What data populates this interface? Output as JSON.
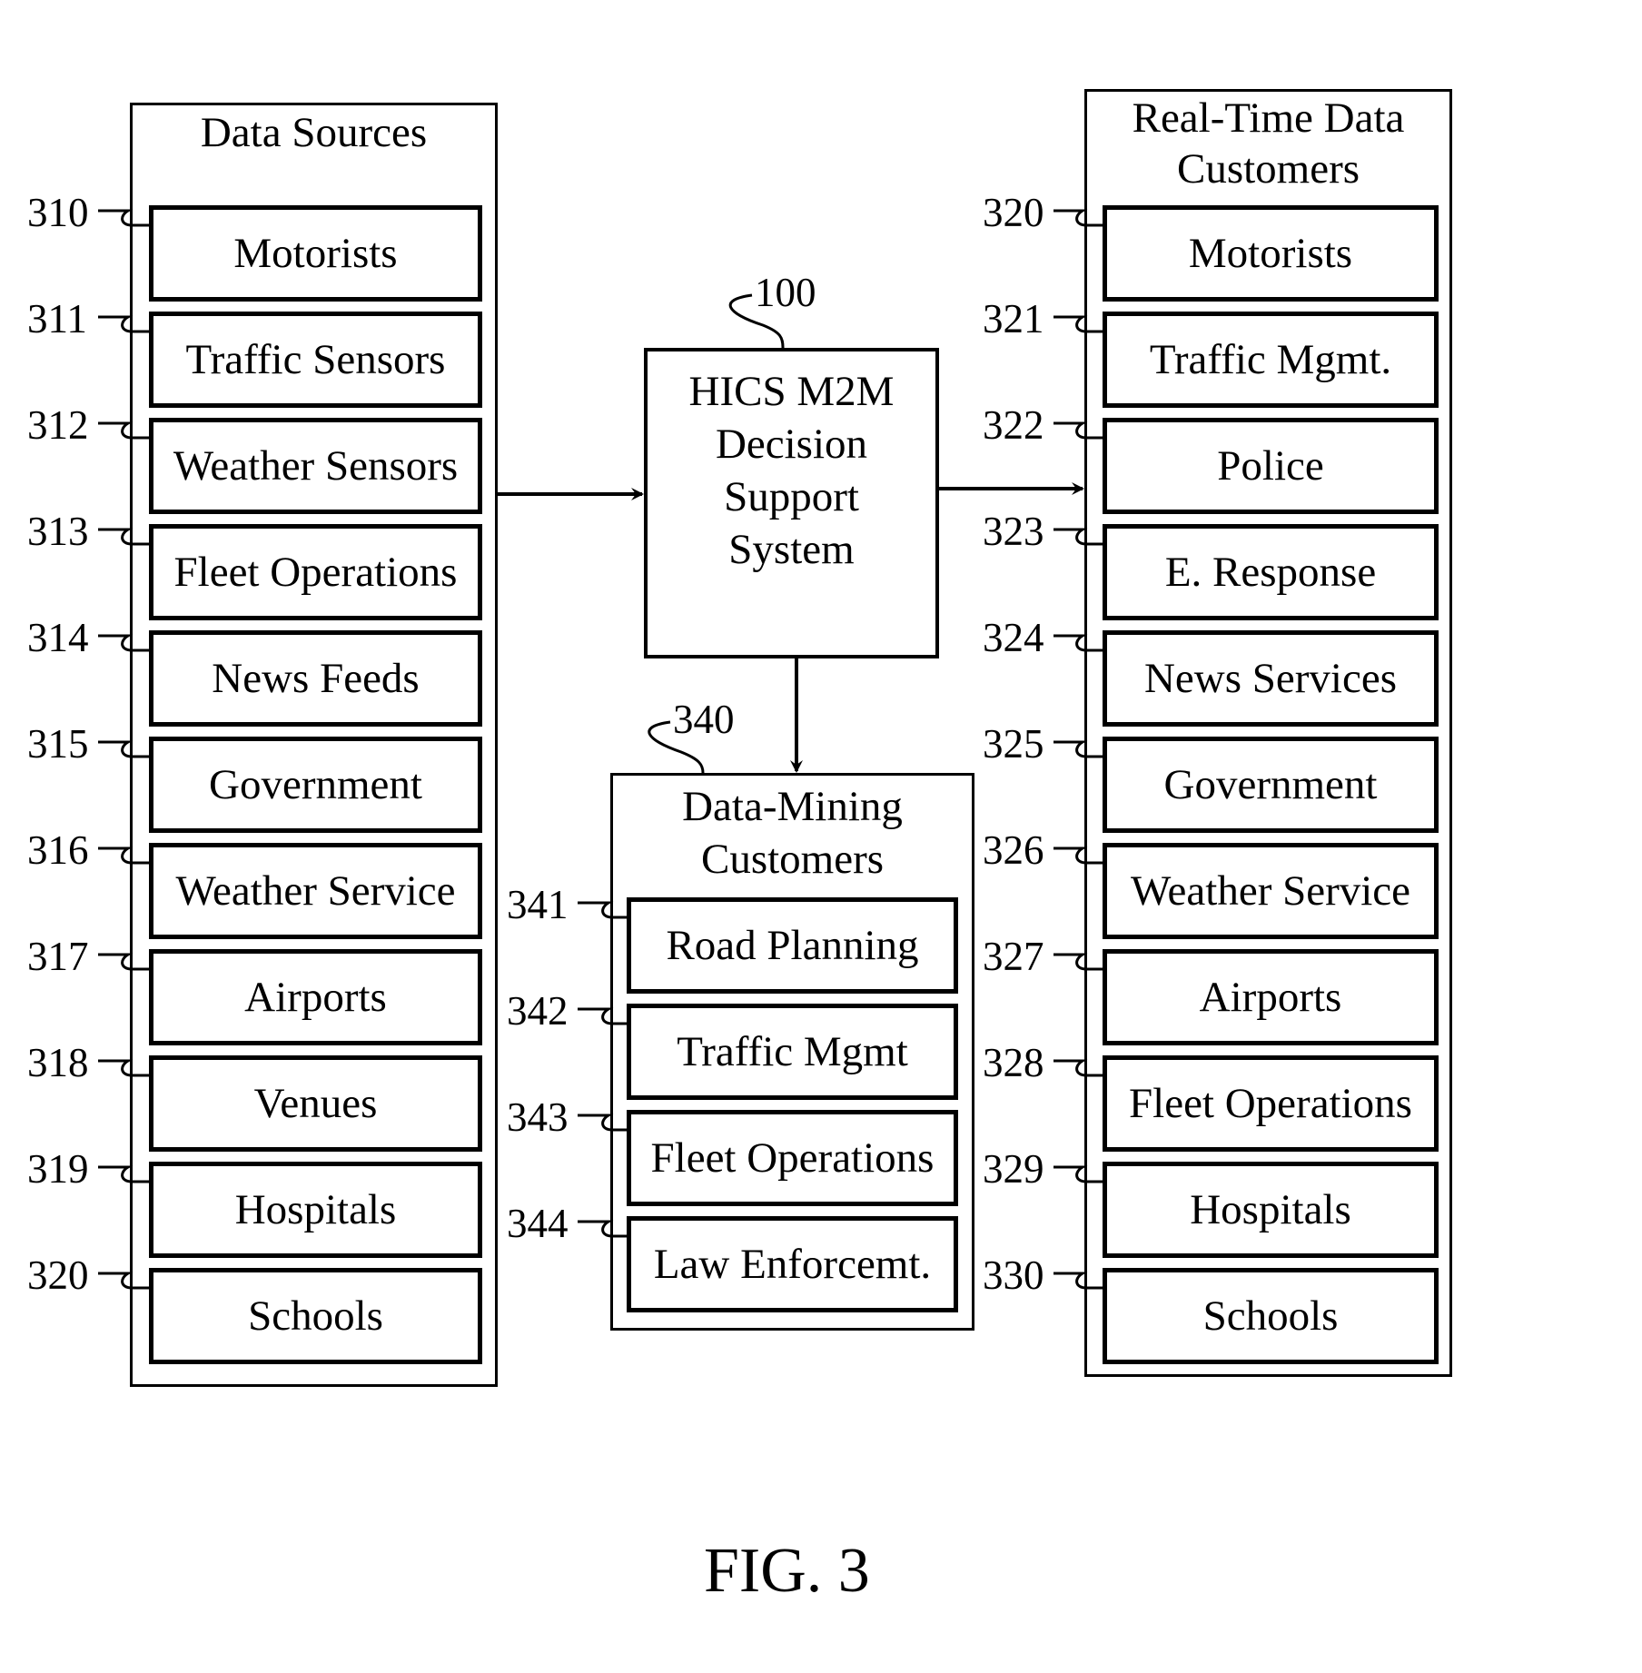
{
  "figure_label": "FIG. 3",
  "data_sources": {
    "title": "Data Sources",
    "items": [
      {
        "ref": "310",
        "label": "Motorists"
      },
      {
        "ref": "311",
        "label": "Traffic Sensors"
      },
      {
        "ref": "312",
        "label": "Weather Sensors"
      },
      {
        "ref": "313",
        "label": "Fleet Operations"
      },
      {
        "ref": "314",
        "label": "News Feeds"
      },
      {
        "ref": "315",
        "label": "Government"
      },
      {
        "ref": "316",
        "label": "Weather Service"
      },
      {
        "ref": "317",
        "label": "Airports"
      },
      {
        "ref": "318",
        "label": "Venues"
      },
      {
        "ref": "319",
        "label": "Hospitals"
      },
      {
        "ref": "320",
        "label": "Schools"
      }
    ]
  },
  "hics": {
    "ref": "100",
    "lines": [
      "HICS M2M",
      "Decision",
      "Support",
      "System"
    ]
  },
  "data_mining": {
    "ref": "340",
    "title_lines": [
      "Data-Mining",
      "Customers"
    ],
    "items": [
      {
        "ref": "341",
        "label": "Road Planning"
      },
      {
        "ref": "342",
        "label": "Traffic Mgmt"
      },
      {
        "ref": "343",
        "label": "Fleet Operations"
      },
      {
        "ref": "344",
        "label": "Law Enforcemt."
      }
    ]
  },
  "realtime": {
    "title_lines": [
      "Real-Time Data",
      "Customers"
    ],
    "items": [
      {
        "ref": "320",
        "label": "Motorists"
      },
      {
        "ref": "321",
        "label": "Traffic Mgmt."
      },
      {
        "ref": "322",
        "label": "Police"
      },
      {
        "ref": "323",
        "label": "E. Response"
      },
      {
        "ref": "324",
        "label": "News Services"
      },
      {
        "ref": "325",
        "label": "Government"
      },
      {
        "ref": "326",
        "label": "Weather Service"
      },
      {
        "ref": "327",
        "label": "Airports"
      },
      {
        "ref": "328",
        "label": "Fleet Operations"
      },
      {
        "ref": "329",
        "label": "Hospitals"
      },
      {
        "ref": "330",
        "label": "Schools"
      }
    ]
  }
}
